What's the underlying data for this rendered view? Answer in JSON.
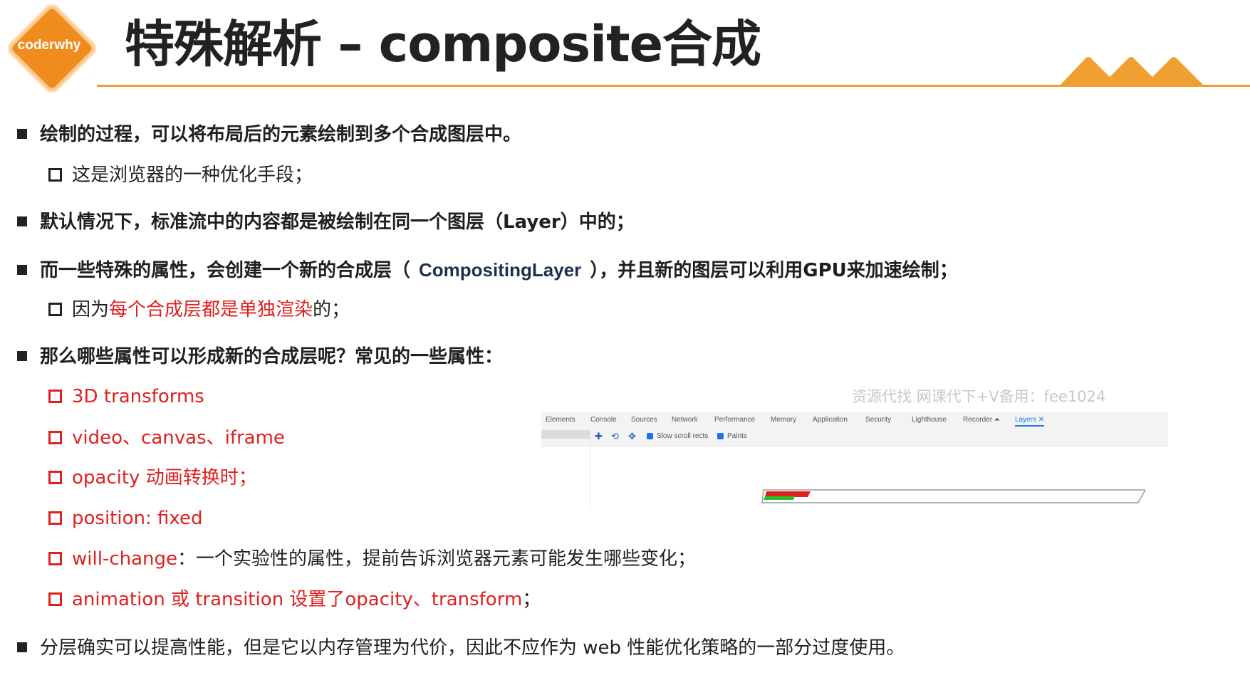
{
  "header": {
    "logo_text": "coderwhy",
    "title": "特殊解析 – composite合成"
  },
  "bullets": {
    "b1": "绘制的过程，可以将布局后的元素绘制到多个合成图层中。",
    "b1_sub": "这是浏览器的一种优化手段；",
    "b2": "默认情况下，标准流中的内容都是被绘制在同一个图层（Layer）中的；",
    "b3_prefix": "而一些特殊的属性，会创建一个新的合成层（",
    "b3_term": "CompositingLayer",
    "b3_suffix": "），并且新的图层可以利用GPU来加速绘制；",
    "b3_sub_prefix": "因为",
    "b3_sub_red": "每个合成层都是单独渲染",
    "b3_sub_suffix": "的；",
    "b4": "那么哪些属性可以形成新的合成层呢？常见的一些属性：",
    "props": {
      "p1": "3D transforms",
      "p2": "video、canvas、iframe",
      "p3": "opacity 动画转换时；",
      "p4": "position: fixed",
      "p5_red": "will-change",
      "p5_rest": "：一个实验性的属性，提前告诉浏览器元素可能发生哪些变化；",
      "p6_red": "animation 或 transition 设置了opacity、transform",
      "p6_rest": "；"
    },
    "b5": "分层确实可以提高性能，但是它以内存管理为代价，因此不应作为 web 性能优化策略的一部分过度使用。"
  },
  "watermark": "资源代找  网课代下+V备用：fee1024",
  "devtools": {
    "tabs": [
      "Elements",
      "Console",
      "Sources",
      "Network",
      "Performance",
      "Memory",
      "Application",
      "Security",
      "Lighthouse",
      "Recorder ⏶",
      "Layers ✕"
    ],
    "toolbar": {
      "slow_scroll": "Slow scroll rects",
      "paints": "Paints"
    }
  },
  "colors": {
    "accent": "#f08c1e",
    "header_line": "#f0a030",
    "emphasis_red": "#e02020"
  }
}
